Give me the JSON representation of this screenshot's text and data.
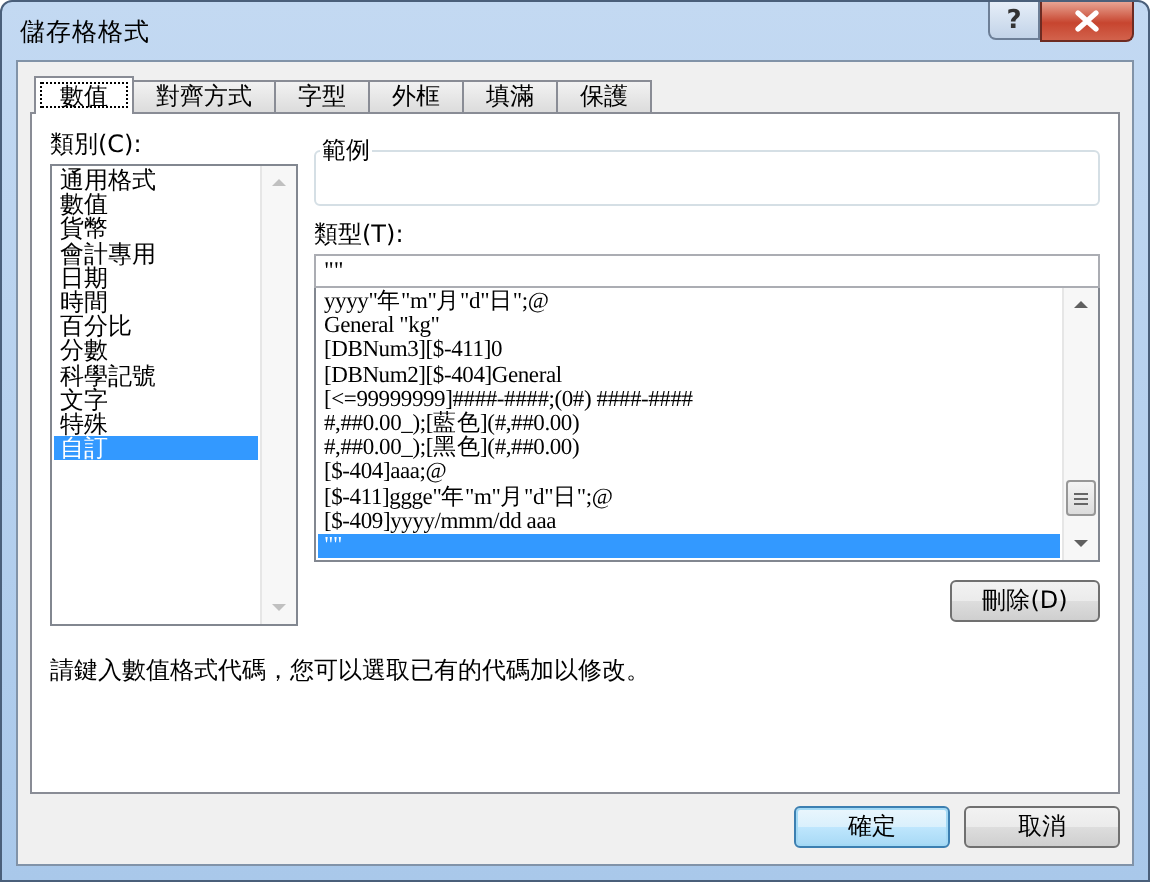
{
  "window": {
    "title": "儲存格格式",
    "help_button": "?"
  },
  "tabs": [
    {
      "label": "數值",
      "selected": true
    },
    {
      "label": "對齊方式",
      "selected": false
    },
    {
      "label": "字型",
      "selected": false
    },
    {
      "label": "外框",
      "selected": false
    },
    {
      "label": "填滿",
      "selected": false
    },
    {
      "label": "保護",
      "selected": false
    }
  ],
  "category": {
    "label": "類別(C):",
    "items": [
      {
        "label": "通用格式",
        "selected": false
      },
      {
        "label": "數值",
        "selected": false
      },
      {
        "label": "貨幣",
        "selected": false
      },
      {
        "label": "會計專用",
        "selected": false
      },
      {
        "label": "日期",
        "selected": false
      },
      {
        "label": "時間",
        "selected": false
      },
      {
        "label": "百分比",
        "selected": false
      },
      {
        "label": "分數",
        "selected": false
      },
      {
        "label": "科學記號",
        "selected": false
      },
      {
        "label": "文字",
        "selected": false
      },
      {
        "label": "特殊",
        "selected": false
      },
      {
        "label": "自訂",
        "selected": true
      }
    ]
  },
  "sample": {
    "label": "範例"
  },
  "type": {
    "label": "類型(T):",
    "value": "\"\"",
    "items": [
      {
        "label": "yyyy\"年\"m\"月\"d\"日\";@",
        "selected": false
      },
      {
        "label": "General \"kg\"",
        "selected": false
      },
      {
        "label": "[DBNum3][$-411]0",
        "selected": false
      },
      {
        "label": "[DBNum2][$-404]General",
        "selected": false
      },
      {
        "label": "[<=99999999]####-####;(0#) ####-####",
        "selected": false
      },
      {
        "label": "#,##0.00_);[藍色](#,##0.00)",
        "selected": false
      },
      {
        "label": "#,##0.00_);[黑色](#,##0.00)",
        "selected": false
      },
      {
        "label": "[$-404]aaa;@",
        "selected": false
      },
      {
        "label": "[$-411]ggge\"年\"m\"月\"d\"日\";@",
        "selected": false
      },
      {
        "label": "[$-409]yyyy/mmm/dd aaa",
        "selected": false
      },
      {
        "label": "\"\"",
        "selected": true
      }
    ]
  },
  "delete_button": "刪除(D)",
  "hint": "請鍵入數值格式代碼，您可以選取已有的代碼加以修改。",
  "buttons": [
    {
      "label": "確定",
      "kind": "default"
    },
    {
      "label": "取消",
      "kind": "normal"
    }
  ]
}
